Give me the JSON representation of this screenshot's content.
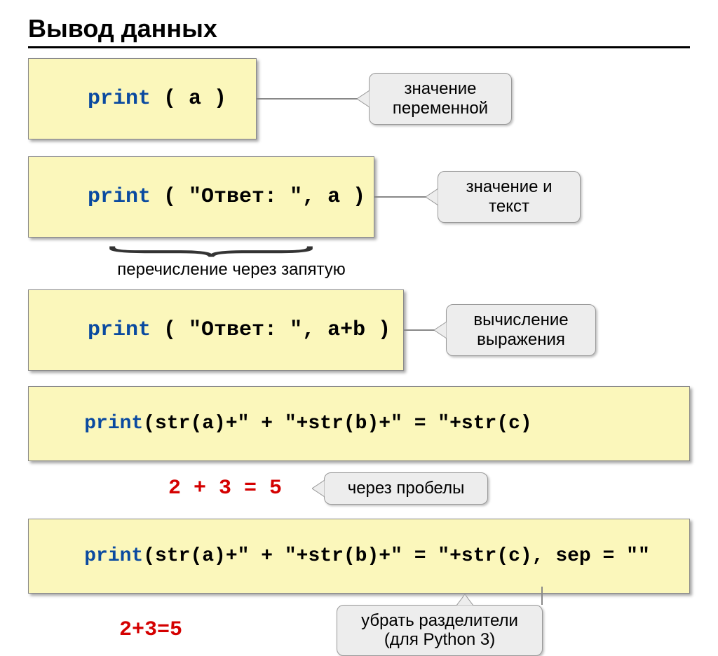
{
  "title": "Вывод данных",
  "code": {
    "box1_kw": "print",
    "box1_rest": " ( a )",
    "box2_kw": "print",
    "box2_rest": " ( \"Ответ: \", a )",
    "box3_kw": "print",
    "box3_rest": " ( \"Ответ: \", a+b )",
    "box4_kw": "print",
    "box4_rest": "(str(a)+\" + \"+str(b)+\" = \"+str(c)",
    "box5_kw": "print",
    "box5_rest": "(str(a)+\" + \"+str(b)+\" = \"+str(c), sep = \"\""
  },
  "callouts": {
    "c1": "значение переменной",
    "c2": "значение и текст",
    "c3": "вычисление выражения",
    "c4": "через пробелы",
    "c5_line1": "убрать разделители",
    "c5_line2": "(для Python 3)"
  },
  "captions": {
    "enum": "перечисление через запятую",
    "result1": "2 + 3 = 5",
    "result2": "2+3=5"
  }
}
